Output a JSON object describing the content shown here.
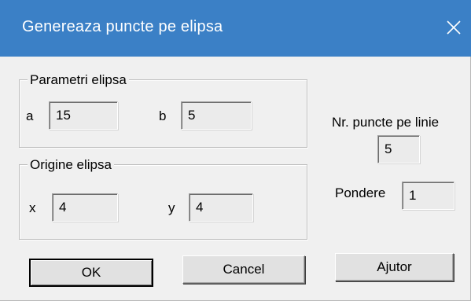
{
  "window": {
    "title": "Genereaza puncte pe elipsa"
  },
  "icons": {
    "close": "close-icon"
  },
  "parametri": {
    "group_label": "Parametri elipsa",
    "a_label": "a",
    "a_value": "15",
    "b_label": "b",
    "b_value": "5"
  },
  "origine": {
    "group_label": "Origine elipsa",
    "x_label": "x",
    "x_value": "4",
    "y_label": "y",
    "y_value": "4"
  },
  "puncte": {
    "label": "Nr. puncte pe linie",
    "value": "5"
  },
  "pondere": {
    "label": "Pondere",
    "value": "1"
  },
  "buttons": {
    "ok": "OK",
    "cancel": "Cancel",
    "help": "Ajutor"
  },
  "colors": {
    "titlebar": "#3b80c6",
    "dialog_bg": "#f0f0f0",
    "field_bg": "#ebebeb"
  }
}
